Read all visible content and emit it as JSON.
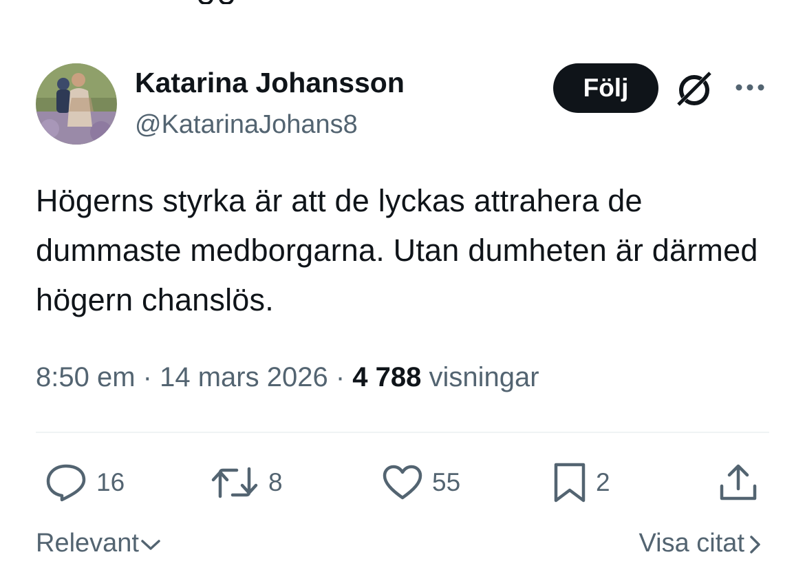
{
  "author": {
    "display_name": "Katarina Johansson",
    "handle": "@KatarinaJohans8"
  },
  "header": {
    "follow_label": "Följ",
    "grok_icon": "grok-icon",
    "more_icon": "more-icon"
  },
  "tweet": {
    "text": "Högerns styrka är att de lyckas attrahera de dummaste medborgarna. Utan dumheten är därmed högern chanslös.",
    "time": "8:50 em",
    "separator": "·",
    "date": "14 mars 2026",
    "views_count": "4 788",
    "views_label": "visningar"
  },
  "actions": {
    "replies": "16",
    "retweets": "8",
    "likes": "55",
    "bookmarks": "2",
    "reply_icon": "reply-icon",
    "retweet_icon": "retweet-icon",
    "like_icon": "heart-icon",
    "bookmark_icon": "bookmark-icon",
    "share_icon": "share-icon"
  },
  "footer": {
    "sort_label": "Relevant",
    "quotes_label": "Visa citat"
  },
  "colors": {
    "text": "#0f1419",
    "secondary": "#536471",
    "divider": "#eff3f4"
  }
}
